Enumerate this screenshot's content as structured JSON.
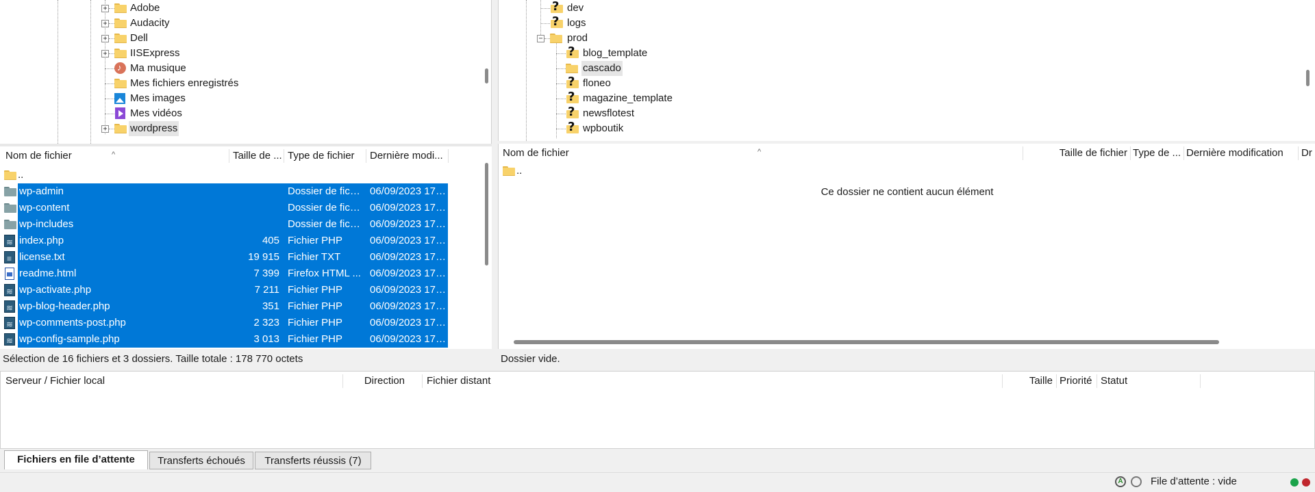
{
  "local_tree": {
    "items": [
      {
        "label": "Adobe",
        "icon": "folder-icon"
      },
      {
        "label": "Audacity",
        "icon": "folder-icon"
      },
      {
        "label": "Dell",
        "icon": "folder-icon"
      },
      {
        "label": "IISExpress",
        "icon": "folder-icon"
      },
      {
        "label": "Ma musique",
        "icon": "music-icon"
      },
      {
        "label": "Mes fichiers enregistrés",
        "icon": "folder-icon"
      },
      {
        "label": "Mes images",
        "icon": "images-icon"
      },
      {
        "label": "Mes vidéos",
        "icon": "video-icon"
      },
      {
        "label": "wordpress",
        "icon": "folder-icon"
      }
    ]
  },
  "remote_tree": {
    "items": [
      {
        "label": "dev",
        "icon": "unknown-folder-icon"
      },
      {
        "label": "logs",
        "icon": "unknown-folder-icon"
      },
      {
        "label": "prod",
        "icon": "folder-icon"
      },
      {
        "label": "blog_template",
        "icon": "unknown-folder-icon"
      },
      {
        "label": "cascado",
        "icon": "folder-icon"
      },
      {
        "label": "floneo",
        "icon": "unknown-folder-icon"
      },
      {
        "label": "magazine_template",
        "icon": "unknown-folder-icon"
      },
      {
        "label": "newsflotest",
        "icon": "unknown-folder-icon"
      },
      {
        "label": "wpboutik",
        "icon": "unknown-folder-icon"
      }
    ]
  },
  "local_list": {
    "columns": {
      "name": "Nom de fichier",
      "size": "Taille de ...",
      "type": "Type de fichier",
      "modified": "Dernière modi..."
    },
    "parent": "..",
    "rows": [
      {
        "name": "wp-admin",
        "size": "",
        "type": "Dossier de fich...",
        "modified": "06/09/2023 17:...",
        "icon": "folder-icon"
      },
      {
        "name": "wp-content",
        "size": "",
        "type": "Dossier de fich...",
        "modified": "06/09/2023 17:...",
        "icon": "folder-icon"
      },
      {
        "name": "wp-includes",
        "size": "",
        "type": "Dossier de fich...",
        "modified": "06/09/2023 17:...",
        "icon": "folder-icon"
      },
      {
        "name": "index.php",
        "size": "405",
        "type": "Fichier PHP",
        "modified": "06/09/2023 17:...",
        "icon": "php-file-icon"
      },
      {
        "name": "license.txt",
        "size": "19 915",
        "type": "Fichier TXT",
        "modified": "06/09/2023 17:...",
        "icon": "txt-file-icon"
      },
      {
        "name": "readme.html",
        "size": "7 399",
        "type": "Firefox HTML ...",
        "modified": "06/09/2023 17:...",
        "icon": "html-file-icon"
      },
      {
        "name": "wp-activate.php",
        "size": "7 211",
        "type": "Fichier PHP",
        "modified": "06/09/2023 17:...",
        "icon": "php-file-icon"
      },
      {
        "name": "wp-blog-header.php",
        "size": "351",
        "type": "Fichier PHP",
        "modified": "06/09/2023 17:...",
        "icon": "php-file-icon"
      },
      {
        "name": "wp-comments-post.php",
        "size": "2 323",
        "type": "Fichier PHP",
        "modified": "06/09/2023 17:...",
        "icon": "php-file-icon"
      },
      {
        "name": "wp-config-sample.php",
        "size": "3 013",
        "type": "Fichier PHP",
        "modified": "06/09/2023 17:...",
        "icon": "php-file-icon"
      }
    ],
    "status": "Sélection de 16 fichiers et 3 dossiers. Taille totale : 178 770 octets"
  },
  "remote_list": {
    "columns": {
      "name": "Nom de fichier",
      "size": "Taille de fichier",
      "type": "Type de ...",
      "modified": "Dernière modification",
      "perms": "Dr"
    },
    "parent": "..",
    "empty_message": "Ce dossier ne contient aucun élément",
    "status": "Dossier vide."
  },
  "queue": {
    "columns": {
      "server": "Serveur / Fichier local",
      "direction": "Direction",
      "remote": "Fichier distant",
      "size": "Taille",
      "priority": "Priorité",
      "status": "Statut"
    }
  },
  "tabs": {
    "queued": "Fichiers en file d’attente",
    "failed": "Transferts échoués",
    "succeeded": "Transferts réussis (7)"
  },
  "statusbar": {
    "queue_text": "File d’attente : vide"
  },
  "colors": {
    "selection": "#0078d7",
    "indicator_green": "#1aa34a",
    "indicator_red": "#c0262d"
  }
}
